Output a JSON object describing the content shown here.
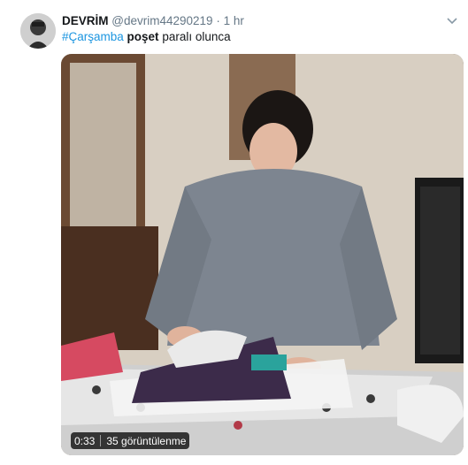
{
  "tweet": {
    "display_name": "DEVRİM",
    "handle": "@devrim44290219",
    "separator": "·",
    "time": "1 hr",
    "text": {
      "hashtag": "#Çarşamba",
      "bold_word": "poşet",
      "rest": "paralı olunca"
    }
  },
  "video": {
    "duration": "0:33",
    "views": "35 görüntülenme"
  },
  "icons": {
    "avatar": "user-avatar",
    "caret": "chevron-down-icon"
  }
}
